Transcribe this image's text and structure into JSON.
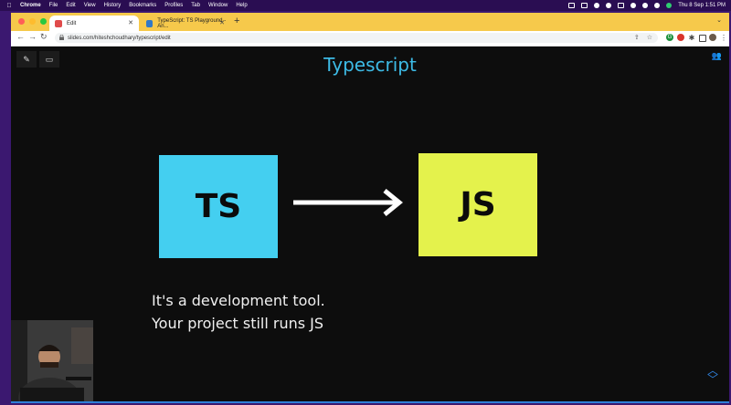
{
  "menubar": {
    "app": "Chrome",
    "items": [
      "File",
      "Edit",
      "View",
      "History",
      "Bookmarks",
      "Profiles",
      "Tab",
      "Window",
      "Help"
    ],
    "datetime": "Thu 8 Sep  1:51 PM"
  },
  "tabs": [
    {
      "title": "Edit",
      "active": true,
      "favicon_color": "#e04b4b"
    },
    {
      "title": "TypeScript: TS Playground - An...",
      "active": false,
      "favicon_color": "#3178c6"
    }
  ],
  "address": {
    "url": "slides.com/hiteshchoudhary/typescript/edit"
  },
  "slide": {
    "title": "Typescript",
    "left_box": "TS",
    "right_box": "JS",
    "line1": "It's a development tool.",
    "line2": "Your project still runs JS"
  },
  "colors": {
    "accent": "#3dbbe6",
    "ts": "#44cff0",
    "js": "#e4f24c",
    "tabbar": "#f6c94b"
  }
}
